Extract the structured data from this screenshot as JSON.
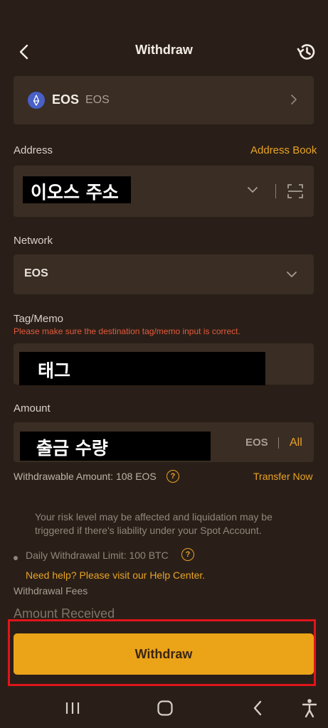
{
  "header": {
    "title": "Withdraw"
  },
  "coin": {
    "symbol": "EOS",
    "name": "EOS"
  },
  "address": {
    "label": "Address",
    "book_link": "Address Book",
    "value": "이오스 주소"
  },
  "network": {
    "label": "Network",
    "value": "EOS"
  },
  "tag": {
    "label": "Tag/Memo",
    "warning": "Please make sure the destination tag/memo input is correct.",
    "value": "태그"
  },
  "amount": {
    "label": "Amount",
    "value": "출금 수량",
    "unit": "EOS",
    "all_label": "All",
    "withdrawable": "Withdrawable Amount: 108 EOS",
    "transfer_now": "Transfer Now"
  },
  "info": {
    "risk_note": "Your risk level may be affected and liquidation may be triggered if there's liability under your Spot Account.",
    "daily_limit": "Daily Withdrawal Limit: 100 BTC",
    "help_link": "Need help? Please visit our Help Center.",
    "fees_label": "Withdrawal Fees",
    "received_label": "Amount Received"
  },
  "withdraw_button": "Withdraw",
  "colors": {
    "accent": "#eba418",
    "background": "#2a1f18",
    "card": "#3a2d24",
    "warning": "#e35a3d",
    "highlight_frame": "#e0151a"
  },
  "icons": [
    "back-icon",
    "history-icon",
    "eos-logo-icon",
    "chevron-right-icon",
    "chevron-down-icon",
    "scan-icon",
    "help-icon",
    "menu-icon",
    "home-icon",
    "back-nav-icon",
    "accessibility-icon"
  ]
}
